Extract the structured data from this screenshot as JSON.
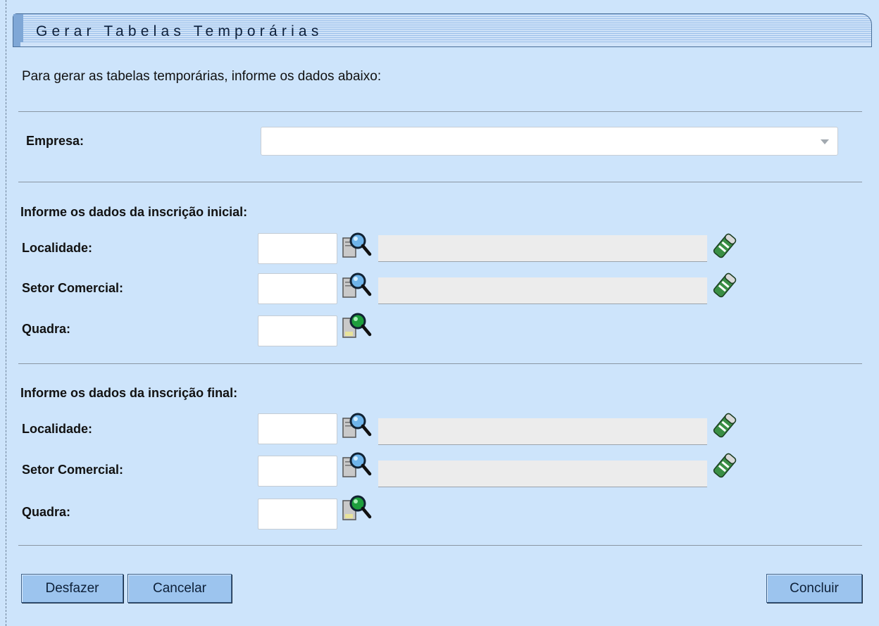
{
  "title": "Gerar Tabelas Temporárias",
  "intro": "Para gerar as tabelas temporárias, informe os dados abaixo:",
  "empresa": {
    "label": "Empresa:",
    "value": ""
  },
  "inicial": {
    "heading": "Informe os dados da inscrição inicial:",
    "localidade": {
      "label": "Localidade:",
      "code": "",
      "description": ""
    },
    "setor": {
      "label": "Setor Comercial:",
      "code": "",
      "description": ""
    },
    "quadra": {
      "label": "Quadra:",
      "code": ""
    }
  },
  "final": {
    "heading": "Informe os dados da inscrição final:",
    "localidade": {
      "label": "Localidade:",
      "code": "",
      "description": ""
    },
    "setor": {
      "label": "Setor Comercial:",
      "code": "",
      "description": ""
    },
    "quadra": {
      "label": "Quadra:",
      "code": ""
    }
  },
  "buttons": {
    "undo": "Desfazer",
    "cancel": "Cancelar",
    "finish": "Concluir"
  },
  "icons": {
    "search": "magnifier-document-icon",
    "quadra_search": "magnifier-document-green-icon",
    "clear": "eraser-icon"
  },
  "colors": {
    "background": "#cde4fb",
    "title_band": "#9cc0ea",
    "button": "#9cc4ee",
    "search_lens_blue": "#6fb4ea",
    "search_lens_green": "#1e9e3c",
    "eraser_green": "#3a8f45"
  }
}
